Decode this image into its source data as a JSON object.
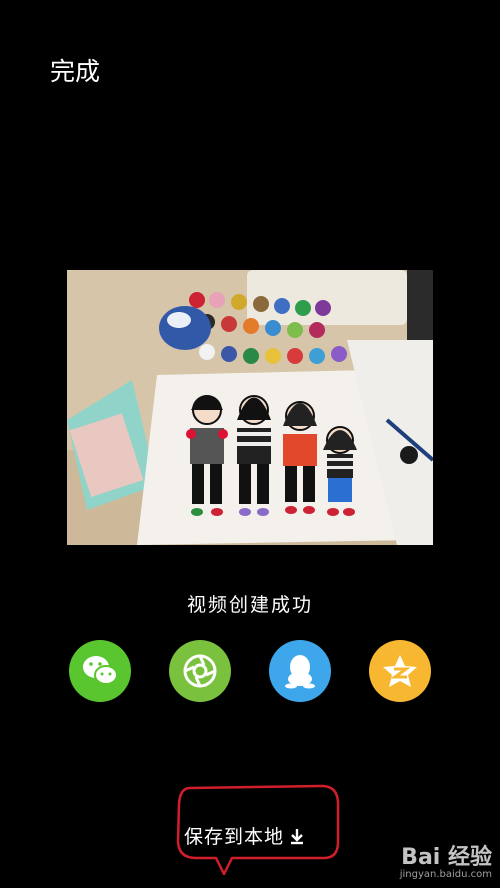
{
  "header": {
    "done_label": "完成"
  },
  "main": {
    "success_text": "视频创建成功",
    "share_buttons": [
      {
        "name": "wechat",
        "icon": "wechat-icon",
        "color": "#5ac62f"
      },
      {
        "name": "moments",
        "icon": "moments-icon",
        "color": "#7ac13d"
      },
      {
        "name": "qq",
        "icon": "qq-icon",
        "color": "#3ea7ec"
      },
      {
        "name": "qzone",
        "icon": "qzone-icon",
        "color": "#f7b730"
      }
    ],
    "save_label": "保存到本地"
  },
  "annotation": {
    "color": "#d21e2c"
  },
  "watermark": {
    "logo": "Bai 经验",
    "url": "jingyan.baidu.com"
  }
}
